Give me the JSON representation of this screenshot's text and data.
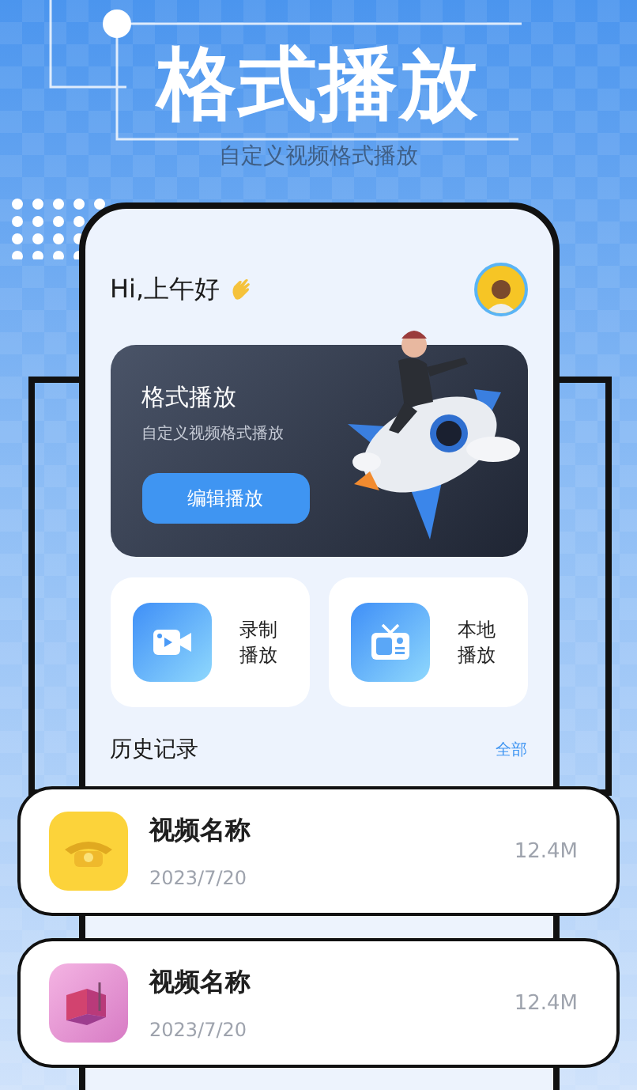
{
  "header": {
    "title": "格式播放",
    "subtitle": "自定义视频格式播放"
  },
  "greeting": "Hi,上午好",
  "banner": {
    "title": "格式播放",
    "subtitle": "自定义视频格式播放",
    "button": "编辑播放"
  },
  "tiles": [
    {
      "kind": "camera",
      "label": "录制播放"
    },
    {
      "kind": "tv",
      "label": "本地播放"
    }
  ],
  "history": {
    "title": "历史记录",
    "link": "全部"
  },
  "videos": [
    {
      "kind": "telephone",
      "name": "视频名称",
      "date": "2023/7/20",
      "size": "12.4M"
    },
    {
      "kind": "room",
      "name": "视频名称",
      "date": "2023/7/20",
      "size": "12.4M"
    }
  ]
}
